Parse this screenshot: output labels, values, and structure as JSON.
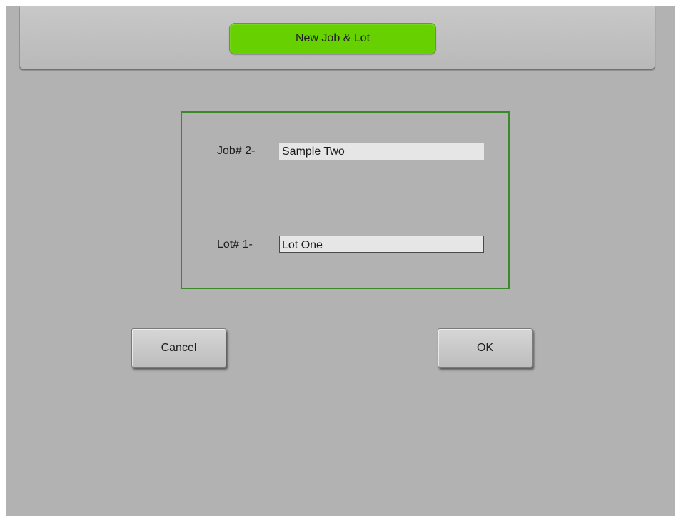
{
  "header": {
    "title": "New Job & Lot"
  },
  "form": {
    "job_label": "Job# 2-",
    "job_value": "Sample Two",
    "lot_label": "Lot# 1-",
    "lot_value": "Lot One"
  },
  "buttons": {
    "cancel_label": "Cancel",
    "ok_label": "OK"
  },
  "colors": {
    "background": "#b2b2b2",
    "title_pill": "#66d000",
    "frame_border": "#3a8a2c"
  }
}
